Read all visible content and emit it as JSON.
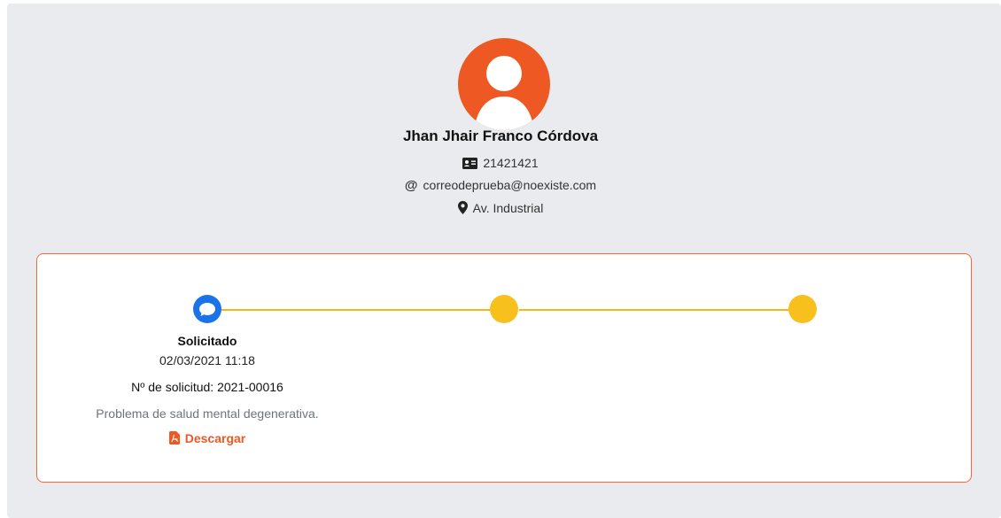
{
  "profile": {
    "name": "Jhan Jhair Franco Córdova",
    "document_id": "21421421",
    "email": "correodeprueba@noexiste.com",
    "address": "Av. Industrial",
    "avatar_color": "#ee5822"
  },
  "timeline": {
    "steps": [
      {
        "state": "active",
        "icon": "chat-icon",
        "color": "#1a73e8"
      },
      {
        "state": "pending",
        "color": "#f7c01c"
      },
      {
        "state": "pending",
        "color": "#f7c01c"
      }
    ],
    "current": {
      "title": "Solicitado",
      "date": "02/03/2021 11:18",
      "request_number": "Nº de solicitud: 2021-00016",
      "description": "Problema de salud mental degenerativa.",
      "download_label": "Descargar"
    }
  },
  "icons": {
    "id_card": "id-card-icon",
    "email": "at-icon",
    "location": "map-pin-icon",
    "download": "file-pdf-icon"
  },
  "colors": {
    "accent": "#ee5822",
    "active_step": "#1a73e8",
    "pending_step": "#f7c01c",
    "background": "#e9ebee"
  }
}
